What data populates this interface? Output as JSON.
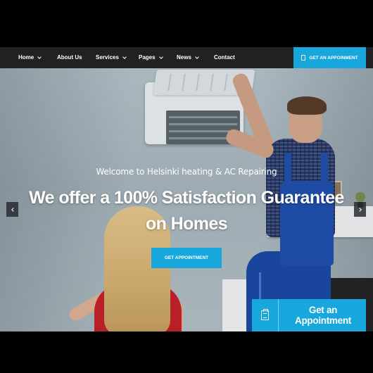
{
  "nav": {
    "items": [
      {
        "label": "Home",
        "has_dropdown": true
      },
      {
        "label": "About Us",
        "has_dropdown": false
      },
      {
        "label": "Services",
        "has_dropdown": true
      },
      {
        "label": "Pages",
        "has_dropdown": true
      },
      {
        "label": "News",
        "has_dropdown": true
      },
      {
        "label": "Contact",
        "has_dropdown": false
      }
    ],
    "cta_label": "GET AN APPOINMENT",
    "cta_icon": "document-icon"
  },
  "hero": {
    "subtitle": "Welcome to Helsinki heating & AC Repairing",
    "title_line1": "We offer a 100% Satisfaction Guarantee",
    "title_line2": "on Homes",
    "button_label": "GET APPOINTMENT",
    "prev_icon": "chevron-left-icon",
    "next_icon": "chevron-right-icon"
  },
  "sticky_cta": {
    "label": "Get an Appointment",
    "icon": "clipboard-icon"
  },
  "colors": {
    "accent": "#18a7dc",
    "nav_bg": "#1f2123",
    "letterbox": "#000000"
  }
}
